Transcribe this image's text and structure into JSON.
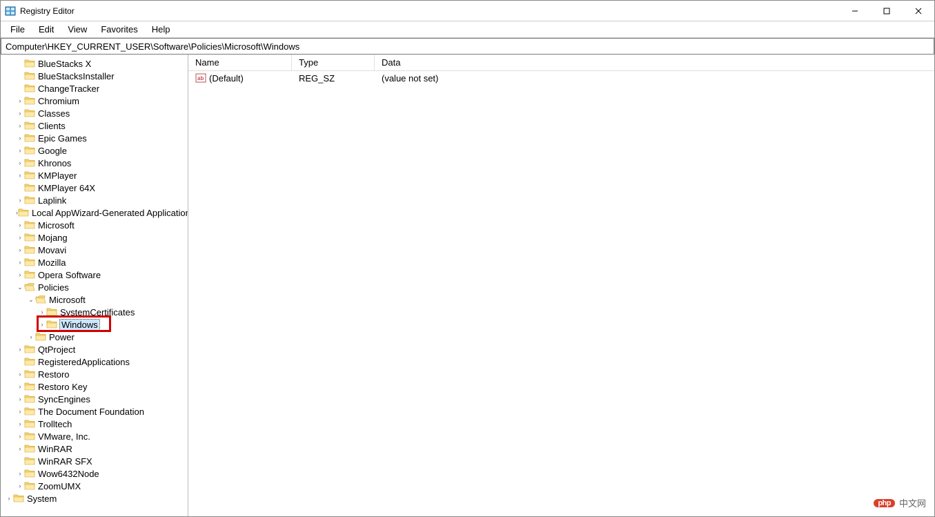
{
  "window": {
    "title": "Registry Editor"
  },
  "menu": {
    "file": "File",
    "edit": "Edit",
    "view": "View",
    "favorites": "Favorites",
    "help": "Help"
  },
  "address": "Computer\\HKEY_CURRENT_USER\\Software\\Policies\\Microsoft\\Windows",
  "columns": {
    "name": "Name",
    "type": "Type",
    "data": "Data"
  },
  "values": [
    {
      "name": "(Default)",
      "type": "REG_SZ",
      "data": "(value not set)"
    }
  ],
  "tree": [
    {
      "label": "BlueStacks X",
      "depth": 4,
      "expandable": false
    },
    {
      "label": "BlueStacksInstaller",
      "depth": 4,
      "expandable": false
    },
    {
      "label": "ChangeTracker",
      "depth": 4,
      "expandable": false
    },
    {
      "label": "Chromium",
      "depth": 4,
      "expandable": true
    },
    {
      "label": "Classes",
      "depth": 4,
      "expandable": true
    },
    {
      "label": "Clients",
      "depth": 4,
      "expandable": true
    },
    {
      "label": "Epic Games",
      "depth": 4,
      "expandable": true
    },
    {
      "label": "Google",
      "depth": 4,
      "expandable": true
    },
    {
      "label": "Khronos",
      "depth": 4,
      "expandable": true
    },
    {
      "label": "KMPlayer",
      "depth": 4,
      "expandable": true
    },
    {
      "label": "KMPlayer 64X",
      "depth": 4,
      "expandable": false
    },
    {
      "label": "Laplink",
      "depth": 4,
      "expandable": true
    },
    {
      "label": "Local AppWizard-Generated Applications",
      "depth": 4,
      "expandable": true
    },
    {
      "label": "Microsoft",
      "depth": 4,
      "expandable": true
    },
    {
      "label": "Mojang",
      "depth": 4,
      "expandable": true
    },
    {
      "label": "Movavi",
      "depth": 4,
      "expandable": true
    },
    {
      "label": "Mozilla",
      "depth": 4,
      "expandable": true
    },
    {
      "label": "Opera Software",
      "depth": 4,
      "expandable": true
    },
    {
      "label": "Policies",
      "depth": 4,
      "expandable": true,
      "expanded": true
    },
    {
      "label": "Microsoft",
      "depth": 5,
      "expandable": true,
      "expanded": true
    },
    {
      "label": "SystemCertificates",
      "depth": 6,
      "expandable": true
    },
    {
      "label": "Windows",
      "depth": 6,
      "expandable": true,
      "selected": true,
      "highlight": true
    },
    {
      "label": "Power",
      "depth": 5,
      "expandable": true
    },
    {
      "label": "QtProject",
      "depth": 4,
      "expandable": true
    },
    {
      "label": "RegisteredApplications",
      "depth": 4,
      "expandable": false
    },
    {
      "label": "Restoro",
      "depth": 4,
      "expandable": true
    },
    {
      "label": "Restoro Key",
      "depth": 4,
      "expandable": true
    },
    {
      "label": "SyncEngines",
      "depth": 4,
      "expandable": true
    },
    {
      "label": "The Document Foundation",
      "depth": 4,
      "expandable": true
    },
    {
      "label": "Trolltech",
      "depth": 4,
      "expandable": true
    },
    {
      "label": "VMware, Inc.",
      "depth": 4,
      "expandable": true
    },
    {
      "label": "WinRAR",
      "depth": 4,
      "expandable": true
    },
    {
      "label": "WinRAR SFX",
      "depth": 4,
      "expandable": false
    },
    {
      "label": "Wow6432Node",
      "depth": 4,
      "expandable": true
    },
    {
      "label": "ZoomUMX",
      "depth": 4,
      "expandable": true
    },
    {
      "label": "System",
      "depth": 3,
      "expandable": true
    }
  ],
  "watermark": {
    "logo": "php",
    "text": "中文网"
  }
}
